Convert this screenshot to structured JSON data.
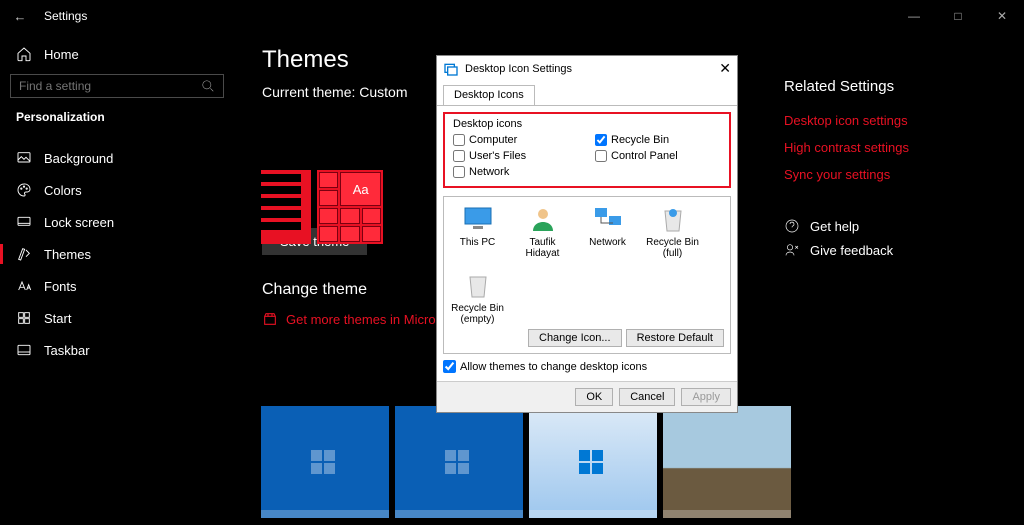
{
  "window": {
    "title": "Settings"
  },
  "sidebar": {
    "home": "Home",
    "search_placeholder": "Find a setting",
    "section": "Personalization",
    "items": [
      {
        "id": "background",
        "label": "Background"
      },
      {
        "id": "colors",
        "label": "Colors"
      },
      {
        "id": "lock-screen",
        "label": "Lock screen"
      },
      {
        "id": "themes",
        "label": "Themes",
        "selected": true
      },
      {
        "id": "fonts",
        "label": "Fonts"
      },
      {
        "id": "start",
        "label": "Start"
      },
      {
        "id": "taskbar",
        "label": "Taskbar"
      }
    ]
  },
  "main": {
    "title": "Themes",
    "current_theme_label": "Current theme: Custom",
    "swatch_sample": "Aa",
    "save_button": "Save theme",
    "change_theme_header": "Change theme",
    "get_more": "Get more themes in Microsoft Store"
  },
  "right": {
    "header": "Related Settings",
    "links": [
      "Desktop icon settings",
      "High contrast settings",
      "Sync your settings"
    ],
    "help": "Get help",
    "feedback": "Give feedback"
  },
  "dialog": {
    "title": "Desktop Icon Settings",
    "tab": "Desktop Icons",
    "group_title": "Desktop icons",
    "checkboxes": [
      {
        "label": "Computer",
        "checked": false
      },
      {
        "label": "Recycle Bin",
        "checked": true
      },
      {
        "label": "User's Files",
        "checked": false
      },
      {
        "label": "Control Panel",
        "checked": false
      },
      {
        "label": "Network",
        "checked": false
      }
    ],
    "icons": [
      "This PC",
      "Taufik Hidayat",
      "Network",
      "Recycle Bin (full)",
      "Recycle Bin (empty)"
    ],
    "change_icon": "Change Icon...",
    "restore_default": "Restore Default",
    "allow_themes": "Allow themes to change desktop icons",
    "ok": "OK",
    "cancel": "Cancel",
    "apply": "Apply"
  }
}
